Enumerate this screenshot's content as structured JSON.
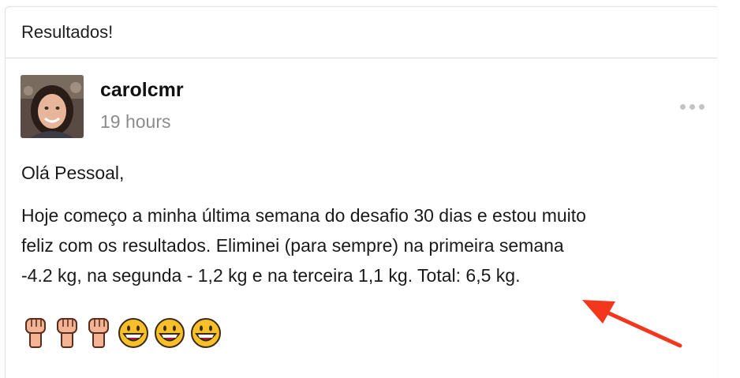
{
  "card": {
    "title": "Resultados!"
  },
  "post": {
    "author": "carolcmr",
    "time": "19 hours",
    "greeting": "Olá Pessoal,",
    "body_line1": "Hoje começo a minha última semana do desafio 30 dias e estou muito",
    "body_line2": "feliz com os resultados. Eliminei (para sempre) na primeira semana",
    "body_line3": "-4.2 kg, na segunda - 1,2 kg e na terceira 1,1 kg. Total: 6,5 kg.",
    "emojis": [
      "raised-fist",
      "raised-fist",
      "raised-fist",
      "grinning-face",
      "grinning-face",
      "grinning-face"
    ]
  },
  "colors": {
    "arrow": "#f2371c",
    "emoji_face": "#f7c02b",
    "emoji_fist": "#f4b393"
  },
  "icons": {
    "more": "ellipsis-icon"
  }
}
